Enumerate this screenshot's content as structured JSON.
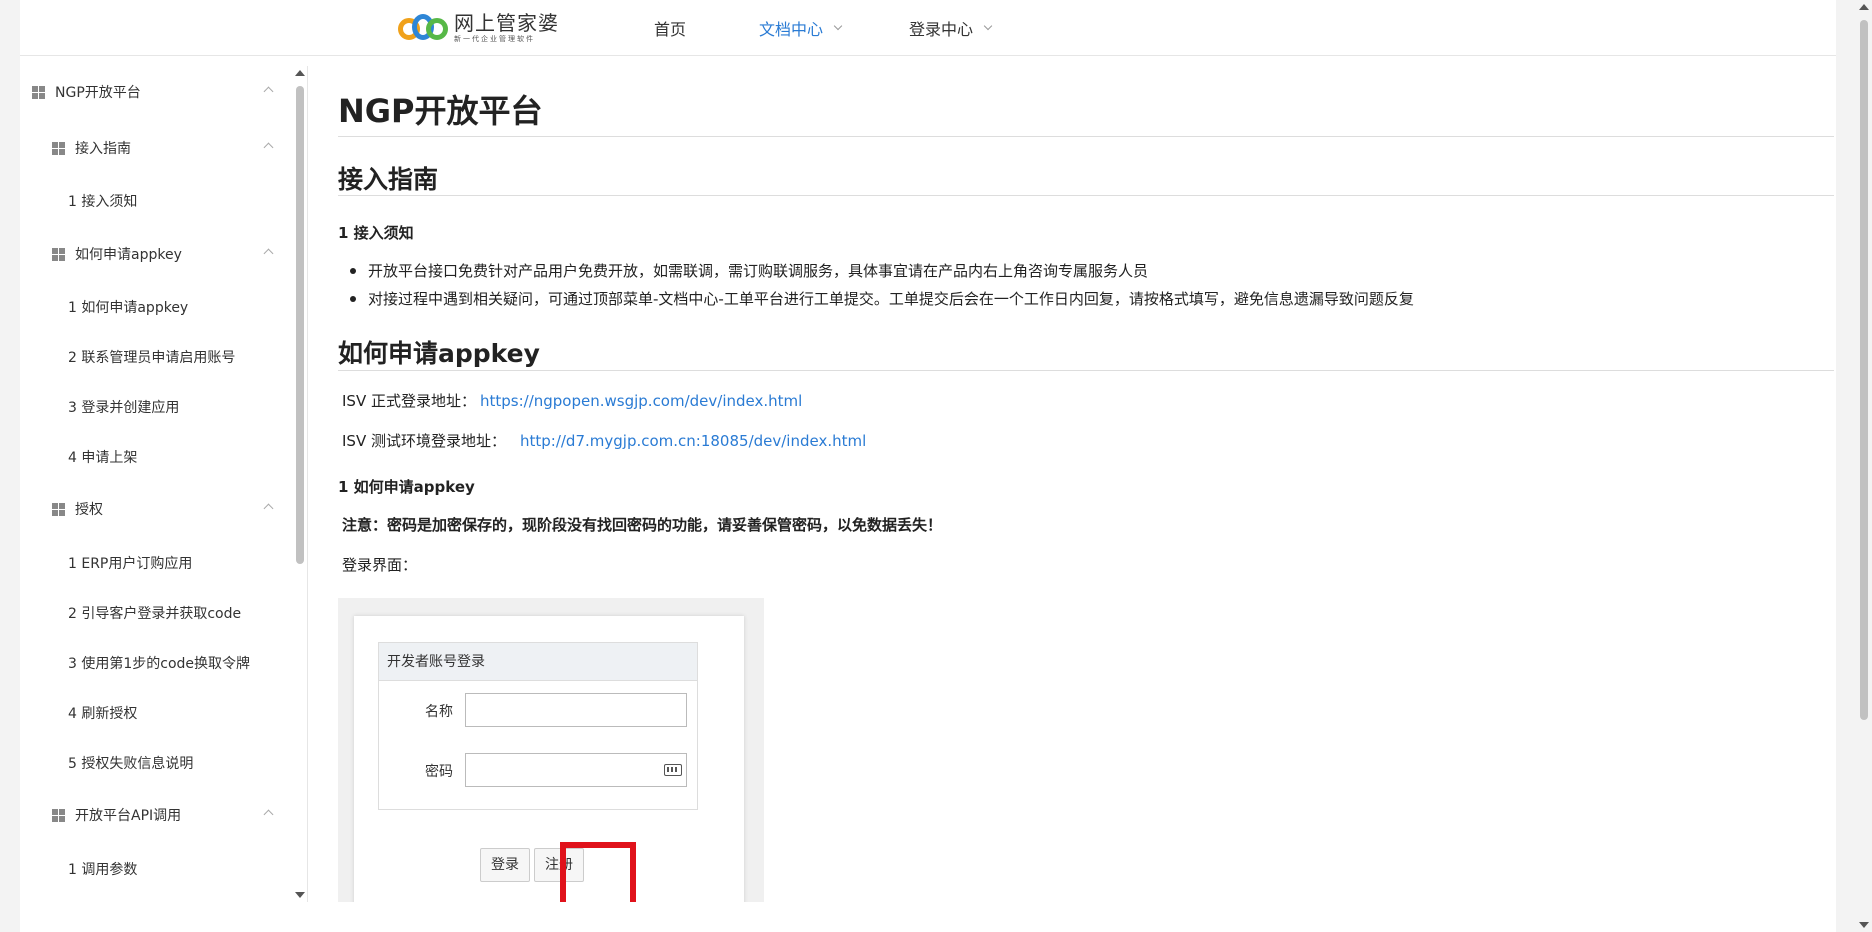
{
  "header": {
    "logo_title": "网上管家婆",
    "logo_subtitle": "新一代企业管理软件",
    "nav": [
      {
        "label": "首页",
        "active": false,
        "dropdown": false
      },
      {
        "label": "文档中心",
        "active": true,
        "dropdown": true
      },
      {
        "label": "登录中心",
        "active": false,
        "dropdown": true
      }
    ]
  },
  "sidebar": {
    "items": [
      {
        "label": "NGP开放平台",
        "level": 1,
        "expandable": true
      },
      {
        "label": "接入指南",
        "level": 2,
        "expandable": true
      },
      {
        "label": "1 接入须知",
        "level": 3
      },
      {
        "label": "如何申请appkey",
        "level": 2,
        "expandable": true
      },
      {
        "label": "1 如何申请appkey",
        "level": 3
      },
      {
        "label": "2 联系管理员申请启用账号",
        "level": 3
      },
      {
        "label": "3 登录并创建应用",
        "level": 3
      },
      {
        "label": "4 申请上架",
        "level": 3
      },
      {
        "label": "授权",
        "level": 2,
        "expandable": true
      },
      {
        "label": "1 ERP用户订购应用",
        "level": 3
      },
      {
        "label": "2 引导客户登录并获取code",
        "level": 3
      },
      {
        "label": "3 使用第1步的code换取令牌",
        "level": 3
      },
      {
        "label": "4 刷新授权",
        "level": 3
      },
      {
        "label": "5 授权失败信息说明",
        "level": 3
      },
      {
        "label": "开放平台API调用",
        "level": 2,
        "expandable": true
      },
      {
        "label": "1 调用参数",
        "level": 3
      }
    ]
  },
  "content": {
    "title": "NGP开放平台",
    "section1_title": "接入指南",
    "section1_sub": "1 接入须知",
    "bullets": [
      "开放平台接口免费针对产品用户免费开放，如需联调，需订购联调服务，具体事宜请在产品内右上角咨询专属服务人员",
      "对接过程中遇到相关疑问，可通过顶部菜单-文档中心-工单平台进行工单提交。工单提交后会在一个工作日内回复，请按格式填写，避免信息遗漏导致问题反复"
    ],
    "section2_title": "如何申请appkey",
    "isv_prod_label": "ISV 正式登录地址：",
    "isv_prod_url": "https://ngpopen.wsgjp.com/dev/index.html",
    "isv_test_label": "ISV 测试环境登录地址：",
    "isv_test_url": "http://d7.mygjp.com.cn:18085/dev/index.html",
    "section2_sub": "1 如何申请appkey",
    "warning": "注意：密码是加密保存的，现阶段没有找回密码的功能，请妥善保管密码，以免数据丢失！",
    "login_label": "登录界面："
  },
  "login_shot": {
    "panel_title": "开发者账号登录",
    "name_label": "名称",
    "password_label": "密码",
    "login_button": "登录",
    "register_button": "注册",
    "highlight_color": "#e0121b"
  }
}
